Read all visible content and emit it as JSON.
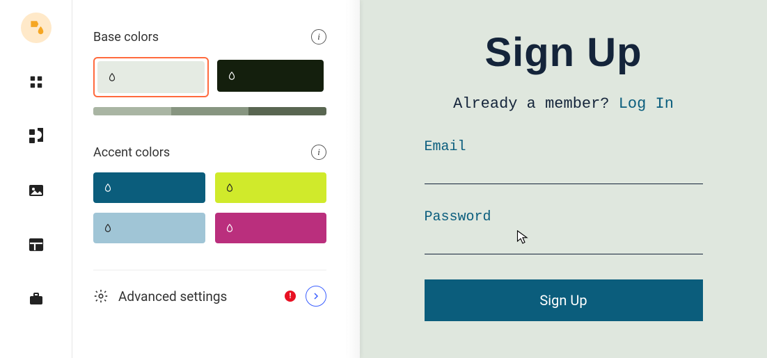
{
  "panel": {
    "base_label": "Base colors",
    "accent_label": "Accent colors",
    "advanced_label": "Advanced settings",
    "base_colors": [
      "#e5ebe3",
      "#141f0d"
    ],
    "shades": [
      "#a9b5a3",
      "#879580",
      "#596651"
    ],
    "accent_colors": [
      "#0b5d7c",
      "#d0ea2b",
      "#a0c5d6",
      "#ba2f7d"
    ]
  },
  "preview": {
    "title": "Sign Up",
    "already": "Already a member? ",
    "login": "Log In",
    "email_label": "Email",
    "password_label": "Password",
    "button_label": "Sign Up"
  }
}
